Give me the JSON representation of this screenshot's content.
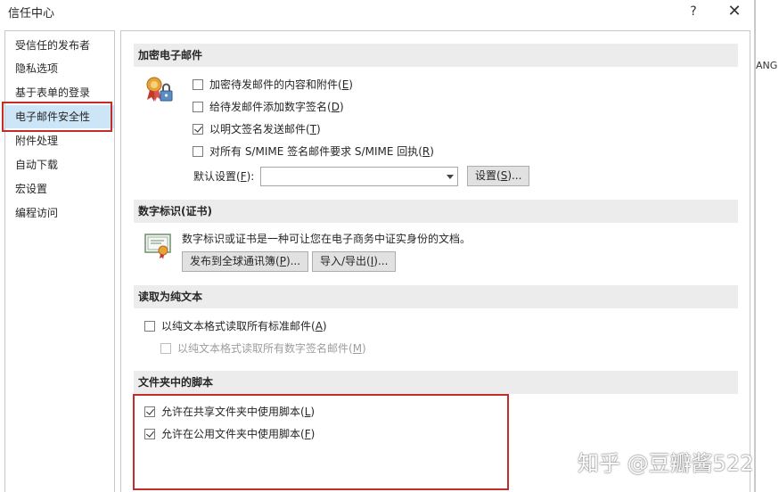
{
  "window": {
    "title": "信任中心",
    "help_icon": "?",
    "close_icon": "✕"
  },
  "outside_text": "ANG",
  "sidebar": {
    "items": [
      {
        "label": "受信任的发布者"
      },
      {
        "label": "隐私选项"
      },
      {
        "label": "基于表单的登录"
      },
      {
        "label": "电子邮件安全性",
        "selected": true
      },
      {
        "label": "附件处理"
      },
      {
        "label": "自动下载"
      },
      {
        "label": "宏设置"
      },
      {
        "label": "编程访问"
      }
    ]
  },
  "encrypted_mail": {
    "heading": "加密电子邮件",
    "icon": "certificate-lock-icon",
    "options": [
      {
        "text": "加密待发邮件的内容和附件(",
        "key": "E",
        "tail": ")",
        "checked": false
      },
      {
        "text": "给待发邮件添加数字签名(",
        "key": "D",
        "tail": ")",
        "checked": false
      },
      {
        "text": "以明文签名发送邮件(",
        "key": "T",
        "tail": ")",
        "checked": true
      },
      {
        "text": "对所有 S/MIME 签名邮件要求 S/MIME 回执(",
        "key": "R",
        "tail": ")",
        "checked": false
      }
    ],
    "default_label": "默认设置(",
    "default_key": "F",
    "default_tail": "):",
    "default_value": "",
    "settings_button": "设置(",
    "settings_key": "S",
    "settings_tail": ")..."
  },
  "digital_id": {
    "heading": "数字标识(证书)",
    "icon": "certificate-icon",
    "description": "数字标识或证书是一种可让您在电子商务中证实身份的文档。",
    "publish_button": "发布到全球通讯簿(",
    "publish_key": "P",
    "publish_tail": ")...",
    "import_button": "导入/导出(",
    "import_key": "I",
    "import_tail": ")..."
  },
  "plain_text": {
    "heading": "读取为纯文本",
    "options": [
      {
        "text": "以纯文本格式读取所有标准邮件(",
        "key": "A",
        "tail": ")",
        "checked": false
      },
      {
        "text": "以纯文本格式读取所有数字签名邮件(",
        "key": "M",
        "tail": ")",
        "checked": false,
        "disabled": true
      }
    ]
  },
  "folder_scripts": {
    "heading": "文件夹中的脚本",
    "options": [
      {
        "text": "允许在共享文件夹中使用脚本(",
        "key": "L",
        "tail": ")",
        "checked": true
      },
      {
        "text": "允许在公用文件夹中使用脚本(",
        "key": "F",
        "tail": ")",
        "checked": true
      }
    ]
  },
  "watermark": "知乎 @豆瓣酱522"
}
